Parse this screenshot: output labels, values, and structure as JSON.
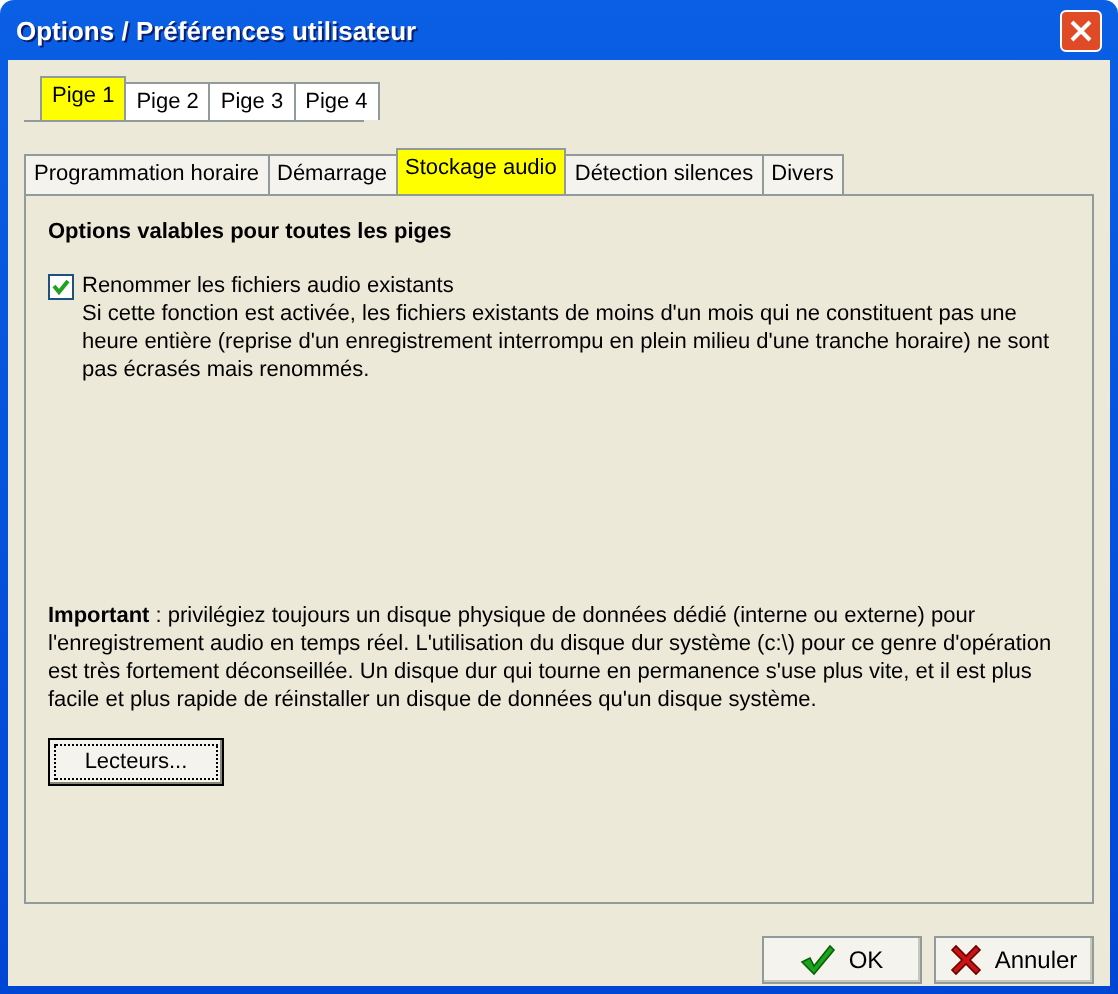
{
  "window": {
    "title": "Options / Préférences utilisateur"
  },
  "page_tabs": [
    {
      "label": "Pige 1",
      "selected": true
    },
    {
      "label": "Pige 2",
      "selected": false
    },
    {
      "label": "Pige 3",
      "selected": false
    },
    {
      "label": "Pige 4",
      "selected": false
    }
  ],
  "tabs": [
    {
      "label": "Programmation horaire",
      "selected": false
    },
    {
      "label": "Démarrage",
      "selected": false
    },
    {
      "label": "Stockage audio",
      "selected": true
    },
    {
      "label": "Détection silences",
      "selected": false
    },
    {
      "label": "Divers",
      "selected": false
    }
  ],
  "panel": {
    "heading": "Options valables pour toutes les piges",
    "option": {
      "label": "Renommer les fichiers audio existants",
      "checked": true,
      "description": "Si cette fonction est activée, les fichiers existants de moins d'un mois qui ne constituent pas une heure entière (reprise d'un enregistrement interrompu en plein milieu d'une tranche horaire) ne sont pas écrasés mais renommés."
    },
    "note": "**Important** : privilégiez toujours un disque physique de données dédié (interne ou externe) pour l'enregistrement audio en temps réel. L'utilisation du disque dur système (c:\\) pour ce genre d'opération est très fortement déconseillée. Un disque dur qui tourne en permanence s'use plus vite, et il est plus facile et plus rapide de réinstaller un disque de données qu'un disque système.",
    "button": "Lecteurs..."
  },
  "buttons": [
    {
      "label": "OK",
      "kind": "ok"
    },
    {
      "label": "Annuler",
      "kind": "cancel"
    }
  ]
}
